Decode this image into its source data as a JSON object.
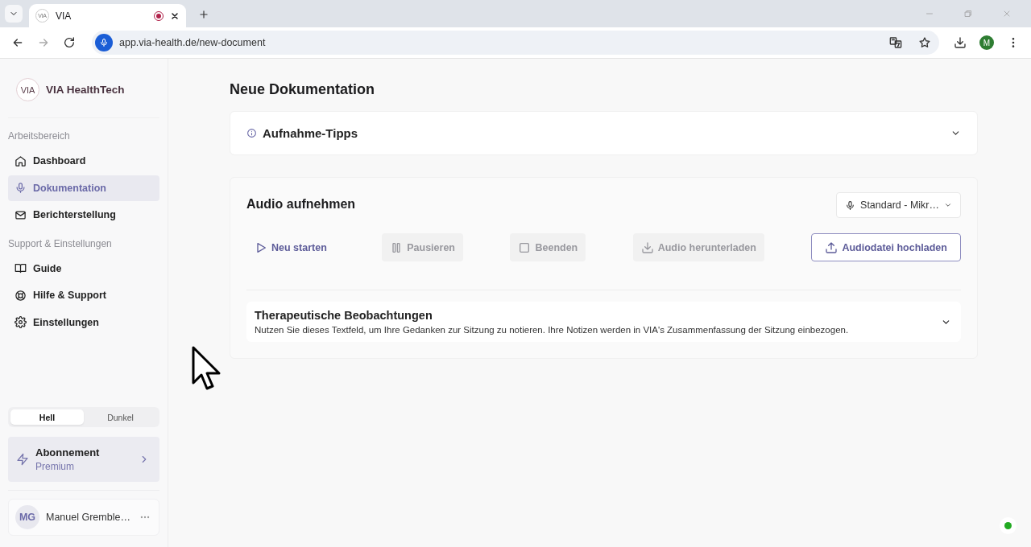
{
  "browser": {
    "tab_title": "VIA",
    "tab_favicon": "VIA",
    "url": "app.via-health.de/new-document",
    "profile_initial": "M"
  },
  "sidebar": {
    "logo": "VIA",
    "brand": "VIA HealthTech",
    "sections": [
      {
        "title": "Arbeitsbereich",
        "items": [
          {
            "label": "Dashboard",
            "selected": false
          },
          {
            "label": "Dokumentation",
            "selected": true
          },
          {
            "label": "Berichterstellung",
            "selected": false
          }
        ]
      },
      {
        "title": "Support & Einstellungen",
        "items": [
          {
            "label": "Guide",
            "selected": false
          },
          {
            "label": "Hilfe & Support",
            "selected": false
          },
          {
            "label": "Einstellungen",
            "selected": false
          }
        ]
      }
    ],
    "theme": [
      {
        "label": "Hell",
        "selected": true
      },
      {
        "label": "Dunkel",
        "selected": false
      }
    ],
    "subscription": {
      "title": "Abonnement",
      "plan": "Premium"
    },
    "user": {
      "initials": "MG",
      "name": "Manuel Gremble…"
    }
  },
  "main": {
    "title": "Neue Dokumentation",
    "tips": {
      "title": "Aufnahme-Tipps",
      "expanded": false
    },
    "audio": {
      "title": "Audio aufnehmen",
      "microphone": "Standard - Mikr…",
      "buttons": [
        {
          "label": "Neu starten",
          "kind": "ghost",
          "disabled": false
        },
        {
          "label": "Pausieren",
          "kind": "ghost",
          "disabled": true
        },
        {
          "label": "Beenden",
          "kind": "ghost",
          "disabled": true
        },
        {
          "label": "Audio herunterladen",
          "kind": "ghost",
          "disabled": true
        },
        {
          "label": "Audiodatei hochladen",
          "kind": "outline",
          "disabled": false
        }
      ],
      "notes": {
        "title": "Therapeutische Beobachtungen",
        "description": "Nutzen Sie dieses Textfeld, um Ihre Gedanken zur Sitzung zu notieren. Ihre Notizen werden in VIA's Zusammenfassung der Sitzung einbezogen.",
        "expanded": false
      }
    }
  },
  "status": {
    "online": true
  }
}
